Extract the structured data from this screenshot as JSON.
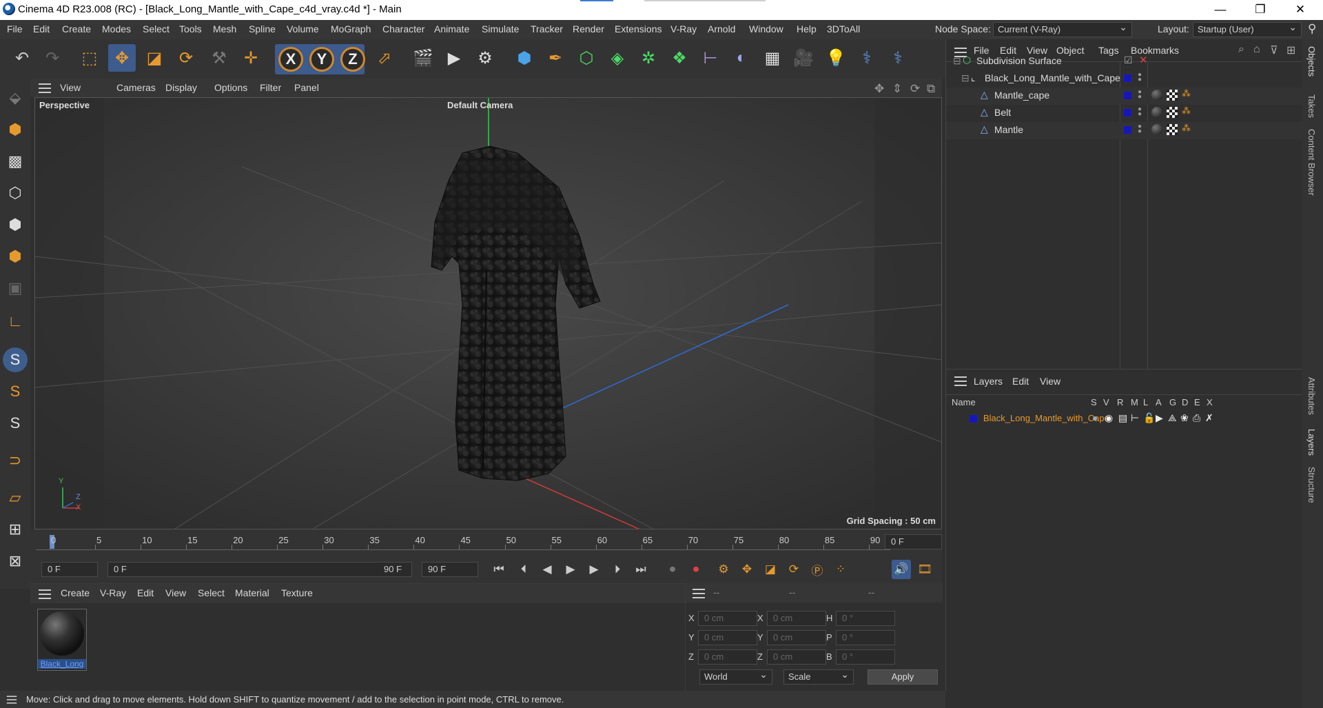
{
  "window": {
    "title": "Cinema 4D R23.008 (RC) - [Black_Long_Mantle_with_Cape_c4d_vray.c4d *] - Main"
  },
  "menu": [
    "File",
    "Edit",
    "Create",
    "Modes",
    "Select",
    "Tools",
    "Mesh",
    "Spline",
    "Volume",
    "MoGraph",
    "Character",
    "Animate",
    "Simulate",
    "Tracker",
    "Render",
    "Extensions",
    "V-Ray",
    "Arnold",
    "Window",
    "Help",
    "3DToAll"
  ],
  "nodespace": {
    "label": "Node Space:",
    "value": "Current (V-Ray)"
  },
  "layout": {
    "label": "Layout:",
    "value": "Startup (User)"
  },
  "viewport": {
    "menu": [
      "View",
      "Cameras",
      "Display",
      "Options",
      "Filter",
      "Panel"
    ],
    "label": "Perspective",
    "camera": "Default Camera",
    "grid_spacing": "Grid Spacing : 50 cm",
    "axis_y": "Y",
    "axis_z": "Z",
    "axis_x": "X"
  },
  "timeline": {
    "ticks": [
      "0",
      "5",
      "10",
      "15",
      "20",
      "25",
      "30",
      "35",
      "40",
      "45",
      "50",
      "55",
      "60",
      "65",
      "70",
      "75",
      "80",
      "85",
      "90"
    ],
    "frame_field": "0 F"
  },
  "playbar": {
    "start": "0 F",
    "range_start": "0 F",
    "range_end": "90 F",
    "end": "90 F"
  },
  "material_manager": {
    "menu": [
      "Create",
      "V-Ray",
      "Edit",
      "View",
      "Select",
      "Material",
      "Texture"
    ],
    "materials": [
      {
        "name": "Black_Long"
      }
    ]
  },
  "coords": {
    "headers": [
      "--",
      "--",
      "--"
    ],
    "rows": [
      {
        "l1": "X",
        "v1": "0 cm",
        "l2": "X",
        "v2": "0 cm",
        "l3": "H",
        "v3": "0 °"
      },
      {
        "l1": "Y",
        "v1": "0 cm",
        "l2": "Y",
        "v2": "0 cm",
        "l3": "P",
        "v3": "0 °"
      },
      {
        "l1": "Z",
        "v1": "0 cm",
        "l2": "Z",
        "v2": "0 cm",
        "l3": "B",
        "v3": "0 °"
      }
    ],
    "mode": "World",
    "type": "Scale",
    "apply": "Apply"
  },
  "status": "Move: Click and drag to move elements. Hold down SHIFT to quantize movement / add to the selection in point mode, CTRL to remove.",
  "object_manager": {
    "menu": [
      "File",
      "Edit",
      "View",
      "Object",
      "Tags",
      "Bookmarks"
    ],
    "objects": [
      {
        "name": "Subdivision Surface"
      },
      {
        "name": "Black_Long_Mantle_with_Cape"
      },
      {
        "name": "Mantle_cape"
      },
      {
        "name": "Belt"
      },
      {
        "name": "Mantle"
      }
    ]
  },
  "layers": {
    "menu": [
      "Layers",
      "Edit",
      "View"
    ],
    "name_header": "Name",
    "cols": [
      "S",
      "V",
      "R",
      "M",
      "L",
      "A",
      "G",
      "D",
      "E",
      "X"
    ],
    "items": [
      {
        "name": "Black_Long_Mantle_with_Cape"
      }
    ]
  },
  "side_tabs": [
    "Objects",
    "Takes",
    "Content Browser",
    "Attributes",
    "Layers",
    "Structure"
  ]
}
